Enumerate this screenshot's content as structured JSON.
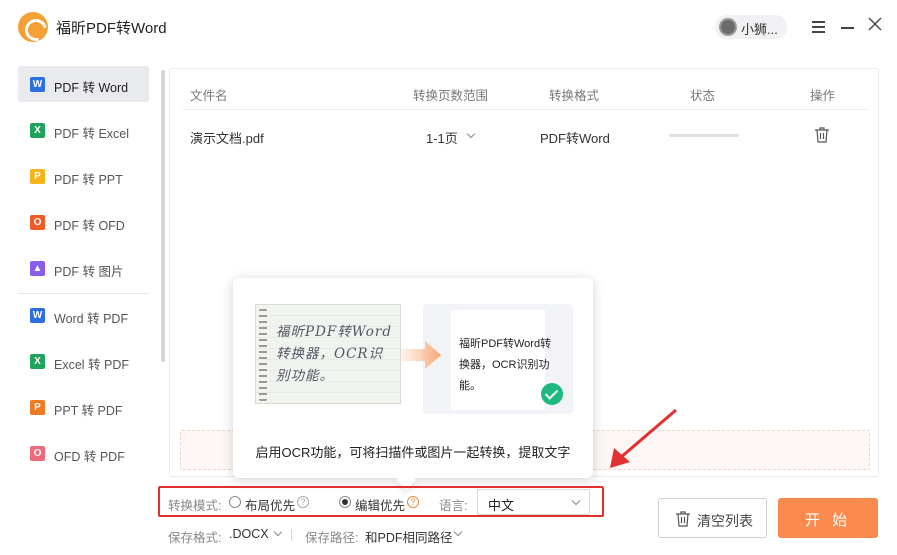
{
  "app": {
    "title": "福昕PDF转Word",
    "user_name": "小狮..."
  },
  "sidebar": {
    "items": [
      {
        "label": "PDF 转 Word",
        "icon": "word-icon",
        "icon_glyph": "W",
        "color": "#2b6fe0",
        "active": true
      },
      {
        "label": "PDF 转 Excel",
        "icon": "excel-icon",
        "icon_glyph": "X",
        "color": "#21a35b"
      },
      {
        "label": "PDF 转 PPT",
        "icon": "ppt-icon",
        "icon_glyph": "P",
        "color": "#f4b41a"
      },
      {
        "label": "PDF 转 OFD",
        "icon": "ofd-icon",
        "icon_glyph": "O",
        "color": "#ef5b26"
      },
      {
        "label": "PDF 转 图片",
        "icon": "image-icon",
        "icon_glyph": "▲",
        "color": "#8a5ee8"
      },
      {
        "label": "Word 转 PDF",
        "icon": "word-pdf-icon",
        "icon_glyph": "W",
        "color": "#2b6fe0"
      },
      {
        "label": "Excel 转 PDF",
        "icon": "excel-pdf-icon",
        "icon_glyph": "X",
        "color": "#21a35b"
      },
      {
        "label": "PPT 转 PDF",
        "icon": "ppt-pdf-icon",
        "icon_glyph": "P",
        "color": "#ef7a22"
      },
      {
        "label": "OFD 转 PDF",
        "icon": "ofd-pdf-icon",
        "icon_glyph": "O",
        "color": "#ef6b7a"
      }
    ]
  },
  "table": {
    "headers": {
      "name": "文件名",
      "range": "转换页数范围",
      "format": "转换格式",
      "status": "状态",
      "action": "操作"
    },
    "rows": [
      {
        "name": "演示文档.pdf",
        "range": "1-1页",
        "format": "PDF转Word",
        "progress": 0
      }
    ]
  },
  "popup": {
    "scan_text": "福昕PDF转Word转换器，OCR识别功能。",
    "doc_text": "福昕PDF转Word转换器，OCR识别功能。",
    "caption": "启用OCR功能，可将扫描件或图片一起转换，提取文字"
  },
  "options": {
    "mode_label": "转换模式:",
    "layout_first": "布局优先",
    "edit_first": "编辑优先",
    "selected_mode": "edit_first",
    "language_label": "语言:",
    "language_value": "中文"
  },
  "footer": {
    "save_format_label": "保存格式:",
    "save_format_value": ".DOCX",
    "save_path_label": "保存路径:",
    "save_path_value": "和PDF相同路径"
  },
  "buttons": {
    "clear": "清空列表",
    "start": "开 始"
  },
  "colors": {
    "accent": "#fb8a4f",
    "annotation_red": "#e23030",
    "success_green": "#1db980"
  }
}
